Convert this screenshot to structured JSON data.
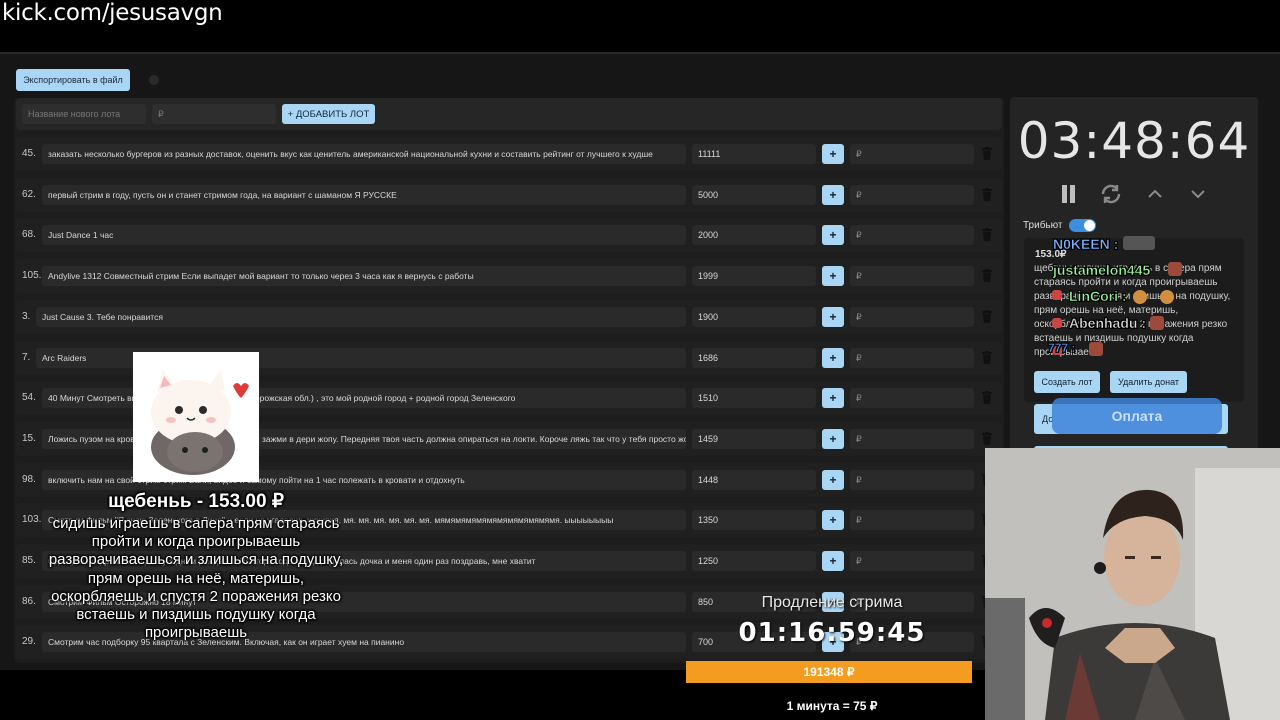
{
  "browser": {
    "url": "kick.com/jesusavgn"
  },
  "toolbar": {
    "export_label": "Экспортировать в файл"
  },
  "add_lot": {
    "name_placeholder": "Название нового лота",
    "amount_placeholder": "₽",
    "add_label": "+ ДОБАВИТЬ ЛОТ"
  },
  "lots": [
    {
      "num": "45.",
      "name": "заказать несколько бургеров из разных доставок, оценить вкус как ценитель американской национальной кухни и составить рейтинг от лучшего к худше",
      "amount": "11111"
    },
    {
      "num": "62.",
      "name": "первый стрим в году, пусть он и станет стримом года, на вариант с шаманом Я РУССКЕ",
      "amount": "5000"
    },
    {
      "num": "68.",
      "name": "Just Dance 1 час",
      "amount": "2000"
    },
    {
      "num": "105.",
      "name": "Andylive 1312 Совместный стрим Если выпадет мой вариант то только через 3 часа как я вернусь с работы",
      "amount": "1999"
    },
    {
      "num": "3.",
      "name": "Just Cause 3. Тебе понравится",
      "amount": "1900"
    },
    {
      "num": "7.",
      "name": "Arc Raiders",
      "amount": "1686"
    },
    {
      "num": "54.",
      "name": "40 Минут Смотреть видео про Зеленский город (Запорожская обл.) , это мой родной город + родной город Зеленского",
      "amount": "1510"
    },
    {
      "num": "15.",
      "name": "Ложись пузом на кровать с торчащей вверх задницей зажми в дери жопу. Передняя твоя часть должна опираться на локти. Короче ляжь так что у тебя просто жопа т",
      "amount": "1459"
    },
    {
      "num": "98.",
      "name": "включить нам на свой стрим стрим Вали, видео и самому пойти на 1 час полежать в кровати и отдохнуть",
      "amount": "1448"
    },
    {
      "num": "103.",
      "name": "Смотрим Фильм \"Я знаю Зеленского в Лицо\" и если не угадаешь ихихяхя, мя. мя. мя. мя. мя. мя. мямямямямямямямямямямямя. ыыыыыыыы",
      "amount": "1350"
    },
    {
      "num": "85.",
      "name": "Один раз поздравь мою дочку с днём рождения Полтора года назад родилась дочка и меня один раз поздравь, мне хватит",
      "amount": "1250"
    },
    {
      "num": "86.",
      "name": "Смотрим Фильм Осторожно 18 минут",
      "amount": "850"
    },
    {
      "num": "29.",
      "name": "Смотрим час подборку 95 квартала с Зеленским. Включая, как он играет хуем на пианино",
      "amount": "700"
    }
  ],
  "lot_field": {
    "currency": "₽",
    "plus": "+"
  },
  "timer": {
    "value": "03:48:64"
  },
  "tribute": {
    "label": "Трибьют"
  },
  "donation": {
    "amount": "153.0₽",
    "text": "щебень: сидишь играешь в сапера прям стараясь пройти и когда проигрываешь разворачиваешься и злишься на подушку, прям орешь на неё, материшь, оскорбляешь и спустя 2 поражения резко встаешь и пиздишь подушку когда проигрываешь",
    "create_label": "Создать лот",
    "remove_label": "Удалить донат",
    "d_label": "До"
  },
  "pay_overlay": {
    "label": "Оплата"
  },
  "chat": [
    {
      "name": "N0KEEN :",
      "color": "#7fb3ff"
    },
    {
      "name": "justamelon445",
      "color": "#9cf09c"
    },
    {
      "name": "LinCori :",
      "color": "#9cf09c"
    },
    {
      "name": "Abenhadu :",
      "color": "#d9d9d9"
    },
    {
      "name": "777 :",
      "color": "#5aa0ff"
    }
  ],
  "alert": {
    "title": "щебеньь - 153.00 ₽",
    "text": "сидишь играешь в сапера прям стараясь пройти и когда проигрываешь разворачиваешься и злишься на подушку, прям орешь на неё, материшь, оскорбляешь и спустя 2 поражения резко встаешь и пиздишь подушку когда проигрываешь"
  },
  "extension": {
    "label": "Продление стрима",
    "timer": "01:16:59:45",
    "total": "191348 ₽",
    "rate": "1 минута = 75 ₽"
  },
  "colors": {
    "accent": "#a9d6f5",
    "orange": "#f39c1f",
    "toggle": "#3d8ee0"
  }
}
